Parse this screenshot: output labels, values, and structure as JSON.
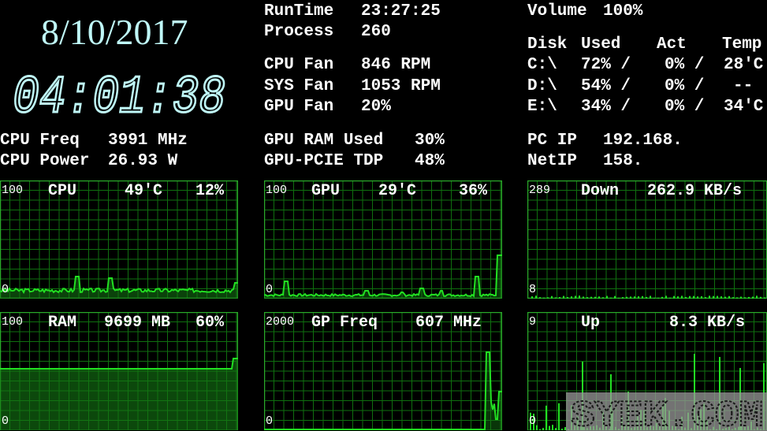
{
  "datetime": {
    "date": "8/10/2017",
    "time": "04:01:38"
  },
  "system": {
    "runtime_label": "RunTime",
    "runtime_value": "23:27:25",
    "process_label": "Process",
    "process_value": "260",
    "cpu_fan_label": "CPU Fan",
    "cpu_fan_value": "846 RPM",
    "sys_fan_label": "SYS Fan",
    "sys_fan_value": "1053 RPM",
    "gpu_fan_label": "GPU Fan",
    "gpu_fan_value": "20%",
    "gpu_ram_label": "GPU RAM Used",
    "gpu_ram_value": "30%",
    "gpu_tdp_label": "GPU-PCIE TDP",
    "gpu_tdp_value": "48%",
    "cpu_freq_label": "CPU Freq",
    "cpu_freq_value": "3991 MHz",
    "cpu_power_label": "CPU Power",
    "cpu_power_value": "26.93 W"
  },
  "volume": {
    "label": "Volume",
    "value": "100%"
  },
  "disks": {
    "header": {
      "disk": "Disk",
      "used": "Used",
      "act": "Act",
      "temp": "Temp"
    },
    "rows": [
      {
        "drive": "C:\\",
        "used": "72% /",
        "act": "0% /",
        "temp": "28'C"
      },
      {
        "drive": "D:\\",
        "used": "54% /",
        "act": "0% /",
        "temp": "--"
      },
      {
        "drive": "E:\\",
        "used": "34% /",
        "act": "0% /",
        "temp": "34'C"
      }
    ]
  },
  "network": {
    "pc_ip_label": "PC IP",
    "pc_ip_value": "192.168.",
    "net_ip_label": "NetIP",
    "net_ip_value": "158."
  },
  "graphs": {
    "cpu": {
      "max": "100",
      "min": "0",
      "label": "CPU",
      "temp": "49'C",
      "value": "12%"
    },
    "gpu": {
      "max": "100",
      "min": "0",
      "label": "GPU",
      "temp": "29'C",
      "value": "36%"
    },
    "down": {
      "max": "289",
      "min": "8",
      "label": "Down",
      "value": "262.9 KB/s"
    },
    "ram": {
      "max": "100",
      "min": "0",
      "label": "RAM",
      "mb": "9699 MB",
      "value": "60%"
    },
    "gpfreq": {
      "max": "2000",
      "min": "0",
      "label": "GP Freq",
      "value": "607 MHz"
    },
    "up": {
      "max": "9",
      "min": "0",
      "label": "Up",
      "value": "8.3 KB/s"
    }
  },
  "watermark": {
    "text": "SYEK.COM"
  },
  "colors": {
    "graph_line": "#22e022",
    "grid": "#0f6f0f",
    "frame": "#2aa82a",
    "date": "#bff7f7"
  }
}
